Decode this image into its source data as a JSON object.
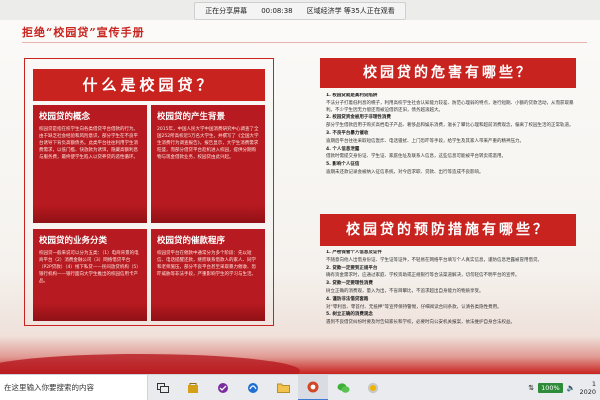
{
  "share_bar": {
    "status": "正在分享屏幕",
    "time": "00:08:38",
    "channel": "区域经济学",
    "viewers": "等35人正在观看"
  },
  "doc": {
    "title": "拒绝“校园贷”宣传手册",
    "left_panel": {
      "title": "什么是校园贷？",
      "cards": [
        {
          "heading": "校园贷的概念",
          "body": "校园贷是指在校学生向各类借贷平台借款的行为。由于缺乏社会经验和风险意识，部分学生在不良平台诱导下背负高额债务。此类平台往往利用学生消费需求，以低门槛、快放款为诱饵，隐藏高额利息与服务费，最终使学生陷入以贷养贷的恶性循环。"
        },
        {
          "heading": "校园贷的产生背景",
          "body": "2015年，中国人民大学中国消费研究中心调查了全国252所高校近5万名大学生，并撰写了《全国大学生消费行为调查报告》。报告显示，大学生消费需求旺盛，而部分借贷平台趁机进入校园，提供分期购物与现金借款业务，校园贷由此兴起。"
        },
        {
          "heading": "校园贷的业务分类",
          "body": "校园贷一般来说可以分为五类：（1）电商背景的电商平台（2）消费金融公司（3）网络借贷平台（P2P贷款）（4）线下私贷——民间放贷机构（5）银行机构——银行面向大学生推出的校园信用卡产品。"
        },
        {
          "heading": "校园贷的催款程序",
          "body": "校园贷平台在催款中通常分为多个阶段：先以短信、电话提醒还款，继而联系借款人的家人、同学和老师施压，部分不良平台甚至采取暴力催收、恐吓威胁等非法手段，严重影响学生的学习与生活。"
        }
      ]
    },
    "harms": {
      "title": "校园贷的危害有哪些？",
      "items": [
        "1. 校园贷就是高利贷陷阱",
        "不法分子打着低利息的幌子，利用高校学生社会认知能力较差、防范心理弱的特点，进行短期、小额的贷款活动，从而获取暴利。不少学生因无力偿还而被迫借新还旧，债务越滚越大。",
        "2. 校园贷资金被用于非理性消费",
        "部分学生借款后用于购买高档电子产品、奢侈品和娱乐消费，滋长了攀比心理和超前消费观念，偏离了校园生活的正常轨道。",
        "3. 不良平台暴力催收",
        "逾期后平台往往采取短信轰炸、电话骚扰、上门恐吓等手段，给学生及其家人带来严重的精神压力。",
        "4. 个人信息泄露",
        "借款时需提交身份证、学生证、家庭住址及联系人信息，这些信息可能被平台转卖或滥用。",
        "5. 影响个人征信",
        "逾期未还款记录会被纳入征信系统，对今后求职、贷款、出行等造成不良影响。"
      ]
    },
    "prevention": {
      "title": "校园贷的预防措施有哪些？",
      "items": [
        "1. 严密保管个人信息及证件",
        "不随意向他人出借身份证、学生证等证件，不轻易在网络平台填写个人真实信息，谨防信息泄露被冒用借贷。",
        "2. 贷款一定要到正规平台",
        "确有资金需求时，应通过家庭、学校资助或正规银行等合法渠道解决，切勿轻信不明平台的宣传。",
        "3. 贷款一定要理性消费",
        "树立正确的消费观，量入为出，不盲目攀比，不追求超出自身能力的物质享受。",
        "4. 谨防非法借贷套路",
        "对“零利息、零首付、无抵押”等宣传保持警惕，仔细阅读合同条款，认清各类隐性费用。",
        "5. 树立正确的消费观念",
        "遇到不良借贷纠纷时要及时告知家长和学校，必要时向公安机关报案，依法维护自身合法权益。"
      ]
    }
  },
  "taskbar": {
    "search_placeholder": "在这里输入你要搜索的内容",
    "battery": "100%",
    "time": "1",
    "date": "2020"
  }
}
